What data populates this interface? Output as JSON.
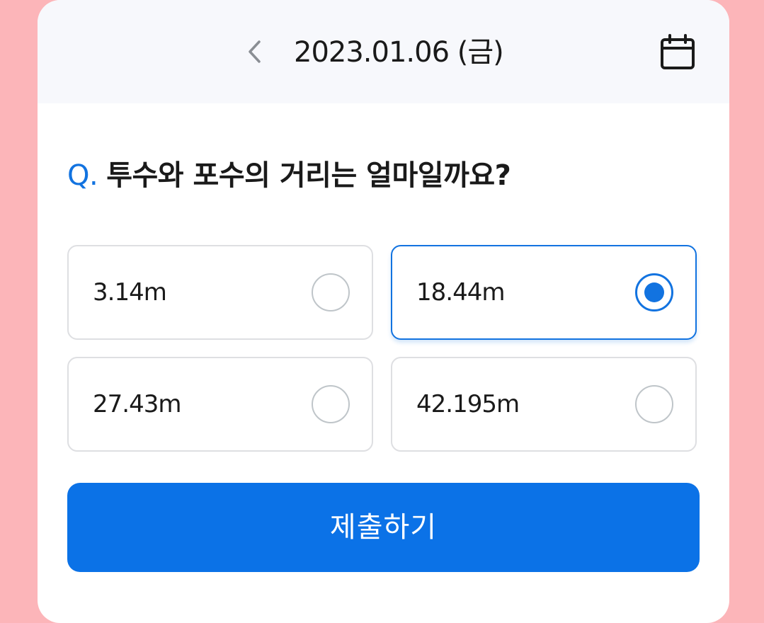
{
  "header": {
    "date": "2023.01.06 (금)",
    "prev_icon": "chevron-left-icon",
    "calendar_icon": "calendar-icon"
  },
  "quiz": {
    "question_prefix": "Q.",
    "question": "투수와 포수의 거리는 얼마일까요?",
    "options": [
      {
        "label": "3.14m",
        "selected": false
      },
      {
        "label": "18.44m",
        "selected": true
      },
      {
        "label": "27.43m",
        "selected": false
      },
      {
        "label": "42.195m",
        "selected": false
      }
    ],
    "submit_label": "제출하기"
  },
  "colors": {
    "accent": "#1273E0",
    "submit": "#0B72E7",
    "background": "#FCB5B9",
    "header_bg": "#F7F8FC"
  }
}
